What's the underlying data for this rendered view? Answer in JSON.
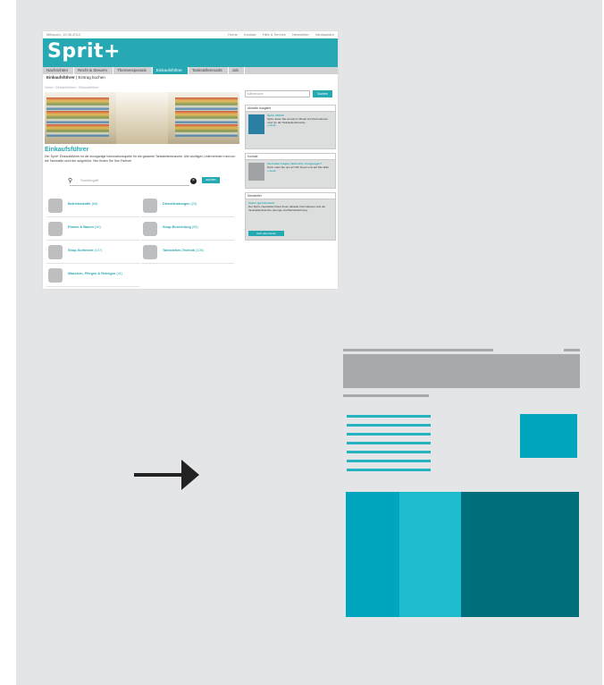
{
  "colors": {
    "panel": "#e4e5e7",
    "brand": "#27a9b3",
    "wireframe_gray": "#a7a9ac",
    "teal_dark": "#006f7c",
    "teal": "#00a6bd",
    "teal_light": "#1ebcce",
    "arrow": "#222222"
  },
  "screenshot": {
    "date": "Mittwoch, 19.06.2013",
    "top_links": [
      "Home",
      "Kontakt",
      "Hilfe & Service",
      "Newsletter",
      "Mediadaten"
    ],
    "logo": "Sprit+",
    "nav_tabs": [
      "Nachrichten",
      "Recht & Steuern",
      "Themenspecials",
      "Einkaufsführer",
      "Tankstellenmarkt",
      "Job"
    ],
    "subnav": {
      "active": "Einkaufsführer",
      "separator": "|",
      "other": "Eintrag buchen"
    },
    "breadcrumb": "Home › Einkaufsführer › Einkaufsführer",
    "title": "Einkaufsführer",
    "intro": "Der Sprit+ Einkaufsführer ist die einzigartige Informationsquelle für die gesamte Tankstellenbranche. Alle wichtigen Unternehmen rund um die Tankstelle sind hier aufgeführt. Hier finden Sie Ihre Partner!",
    "search_placeholder": "Suchbegriff",
    "search_button": "suchen",
    "categories": [
      {
        "name": "Betriebsstoffe",
        "count": "(68)",
        "icon": "oil-can-icon"
      },
      {
        "name": "Dienstleistungen",
        "count": "(23)",
        "icon": "service-icon"
      },
      {
        "name": "Planen & Bauen",
        "count": "(46)",
        "icon": "construction-icon"
      },
      {
        "name": "Shop-Einrichtung",
        "count": "(95)",
        "icon": "shelf-icon"
      },
      {
        "name": "Shop-Sortiment",
        "count": "(107)",
        "icon": "products-icon"
      },
      {
        "name": "Tankstellen-Technik",
        "count": "(106)",
        "icon": "pump-icon"
      },
      {
        "name": "Waschen, Pflegen & Reinigen",
        "count": "(41)",
        "icon": "carwash-icon"
      }
    ],
    "sidebar": {
      "search_placeholder": "Volltextsuche",
      "search_button": "Suchen",
      "issue": {
        "header": "Aktuelle Ausgabe",
        "title": "Sprit+ 6/2013",
        "text": "Sprit+ lesen Sie einmal im Monat mit Informationen rund um die Tankstellenbranche.",
        "link": "» mehr"
      },
      "contact": {
        "header": "Kontakt",
        "title": "Sie haben Fragen, Wünsche, Anregungen?",
        "text": "Dann rufen Sie uns an! Wir freuen uns auf Ihre Mail.",
        "link": "» mehr"
      },
      "newsletter": {
        "header": "Newsletter",
        "title": "Immer gut informiert",
        "text": "Der Sprit+ Newsletter bietet Ihnen aktuelle Informationen aus der Tankstellenbranche, Energie und Betriebsführung.",
        "button": "Jetzt abonnieren"
      }
    }
  }
}
